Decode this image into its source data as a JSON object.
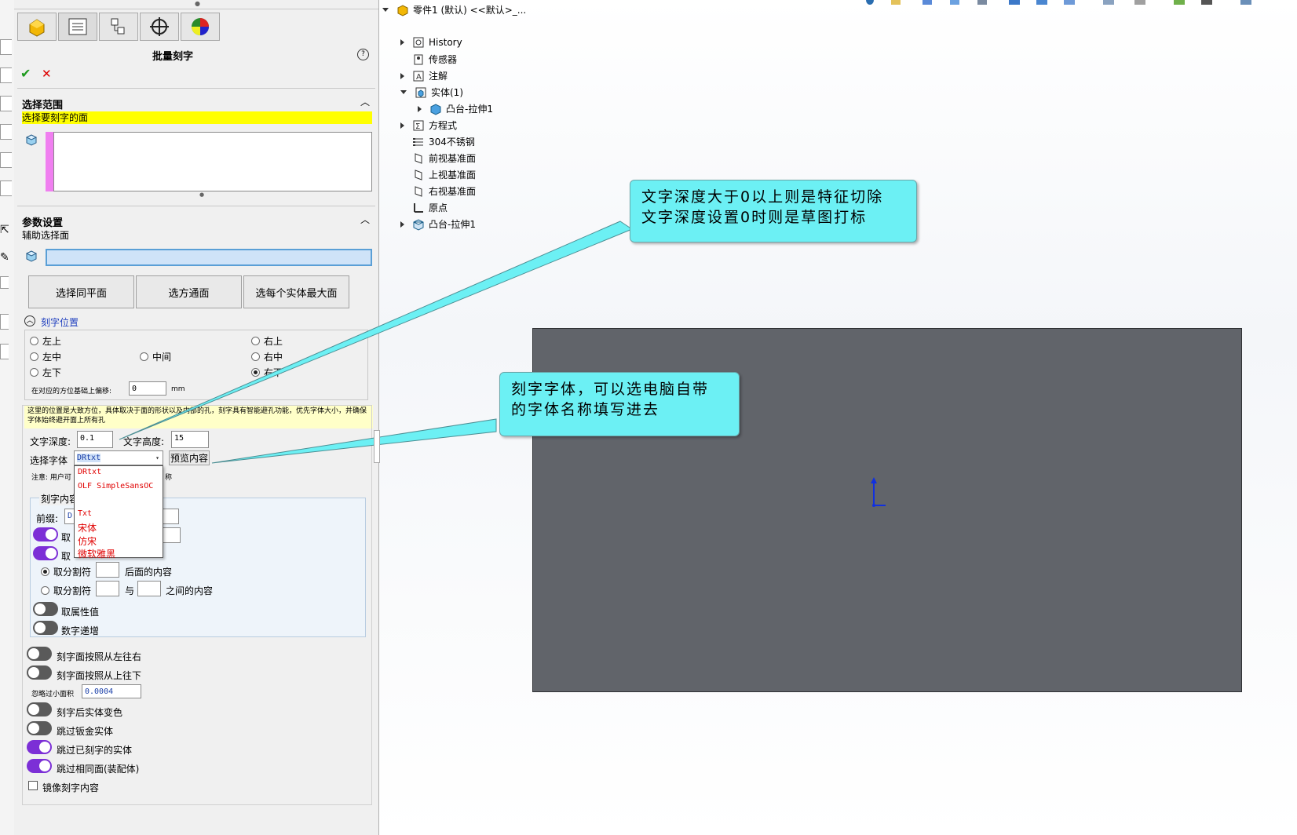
{
  "panel": {
    "title": "批量刻字",
    "help_icon": "?",
    "ok_icon": "✔",
    "cancel_icon": "✕",
    "tabs": [
      "feature-manager-icon",
      "property-manager-icon",
      "configuration-manager-icon",
      "dimxpert-icon",
      "display-manager-icon"
    ],
    "section1": {
      "title": "选择范围",
      "highlight": "选择要刻字的面"
    },
    "section2": {
      "title": "参数设置",
      "aux_label": "辅助选择面",
      "buttons": [
        "选择同平面",
        "选方通面",
        "选每个实体最大面"
      ]
    },
    "position": {
      "title": "刻字位置",
      "radios": [
        {
          "label": "左上",
          "checked": false
        },
        {
          "label": "右上",
          "checked": false
        },
        {
          "label": "左中",
          "checked": false
        },
        {
          "label": "中间",
          "checked": false
        },
        {
          "label": "右中",
          "checked": false
        },
        {
          "label": "左下",
          "checked": false
        },
        {
          "label": "右下",
          "checked": true
        }
      ],
      "offset_label": "在对应的方位基础上偏移:",
      "offset_value": "0",
      "offset_unit": "mm"
    },
    "note": "这里的位置是大致方位，具体取决于面的形状以及内部的孔，刻字具有智能避孔功能，优先字体大小，并确保字体始终避开面上所有孔",
    "depth_label": "文字深度:",
    "depth_value": "0.1",
    "height_label": "文字高度:",
    "height_value": "15",
    "font_label": "选择字体",
    "font_value": "DRtxt",
    "preview_button": "预览内容",
    "note2_prefix": "注意: 用户可",
    "note2_suffix": "称",
    "dropdown": [
      "DRtxt",
      "OLF SimpleSansOC",
      "",
      "Txt",
      "宋体",
      "仿宋",
      "微软雅黑"
    ],
    "content_group": {
      "title": "刻字内容",
      "prefix_label": "前缀:",
      "prefix_value": "D",
      "toggle1_label": "取",
      "toggle2_label": "取",
      "radio1_label": "取分割符",
      "radio1_suffix": "后面的内容",
      "radio2_label": "取分割符",
      "radio2_mid": "与",
      "radio2_suffix": "之间的内容",
      "toggle3_label": "取属性值",
      "toggle4_label": "数字递增"
    },
    "options": {
      "opt1": "刻字面按照从左往右",
      "opt2": "刻字面按照从上往下",
      "min_area_label": "忽略过小面积",
      "min_area_value": "0.0004",
      "opt3": "刻字后实体变色",
      "opt4": "跳过钣金实体",
      "opt5": "跳过已刻字的实体",
      "opt6": "跳过相同面(装配体)",
      "mirror": "镜像刻字内容"
    }
  },
  "tree": {
    "root": "零件1 (默认) <<默认>_...",
    "items": [
      {
        "label": "History",
        "icon": "history-icon",
        "expand": "right"
      },
      {
        "label": "传感器",
        "icon": "sensor-icon",
        "expand": "none"
      },
      {
        "label": "注解",
        "icon": "annotation-icon",
        "expand": "right"
      },
      {
        "label": "实体(1)",
        "icon": "solid-bodies-icon",
        "expand": "down"
      },
      {
        "label": "凸台-拉伸1",
        "icon": "body-icon",
        "expand": "right",
        "indent": 1
      },
      {
        "label": "方程式",
        "icon": "equation-icon",
        "expand": "right"
      },
      {
        "label": "304不锈钢",
        "icon": "material-icon",
        "expand": "none"
      },
      {
        "label": "前视基准面",
        "icon": "plane-icon",
        "expand": "none"
      },
      {
        "label": "上视基准面",
        "icon": "plane-icon",
        "expand": "none"
      },
      {
        "label": "右视基准面",
        "icon": "plane-icon",
        "expand": "none"
      },
      {
        "label": "原点",
        "icon": "origin-icon",
        "expand": "none"
      },
      {
        "label": "凸台-拉伸1",
        "icon": "extrude-icon",
        "expand": "right"
      }
    ]
  },
  "callouts": {
    "c1_line1": "文字深度大于0以上则是特征切除",
    "c1_line2": "文字深度设置0时则是草图打标",
    "c2_line1": "刻字字体，可以选电脑自带",
    "c2_line2": "的字体名称填写进去"
  },
  "colors": {
    "accent_toggle": "#7c2fd6",
    "highlight": "#ffff00",
    "callout": "#6cf0f4",
    "part": "#61646a"
  }
}
